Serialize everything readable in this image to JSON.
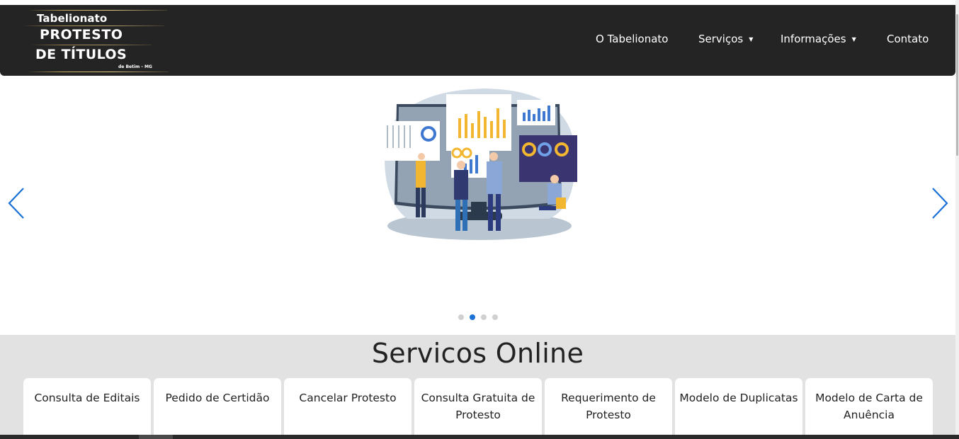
{
  "logo": {
    "line1": "Tabelionato",
    "line2": "PROTESTO",
    "line3": "DE TÍTULOS",
    "line4": "de Betim - MG"
  },
  "nav": {
    "items": [
      {
        "label": "O Tabelionato",
        "has_dropdown": false
      },
      {
        "label": "Serviços",
        "has_dropdown": true
      },
      {
        "label": "Informações",
        "has_dropdown": true
      },
      {
        "label": "Contato",
        "has_dropdown": false
      }
    ],
    "caret": "▼"
  },
  "carousel": {
    "slide_count": 4,
    "active_slide": 2,
    "prev_icon": "chevron-left-icon",
    "next_icon": "chevron-right-icon",
    "slide_image": "data-dashboard-team-illustration",
    "arrow_color": "#1b71d6"
  },
  "services": {
    "title": "Servicos Online",
    "cards": [
      {
        "label": "Consulta de Editais"
      },
      {
        "label": "Pedido de Certidão"
      },
      {
        "label": "Cancelar Protesto"
      },
      {
        "label": "Consulta Gratuita de Protesto"
      },
      {
        "label": "Requerimento de Protesto"
      },
      {
        "label": "Modelo de Duplicatas"
      },
      {
        "label": "Modelo de Carta de Anuência"
      }
    ]
  },
  "colors": {
    "header_bg": "#242424",
    "accent": "#1b71d6",
    "gold": "#c9a95e",
    "services_bg": "#e2e2e2"
  }
}
